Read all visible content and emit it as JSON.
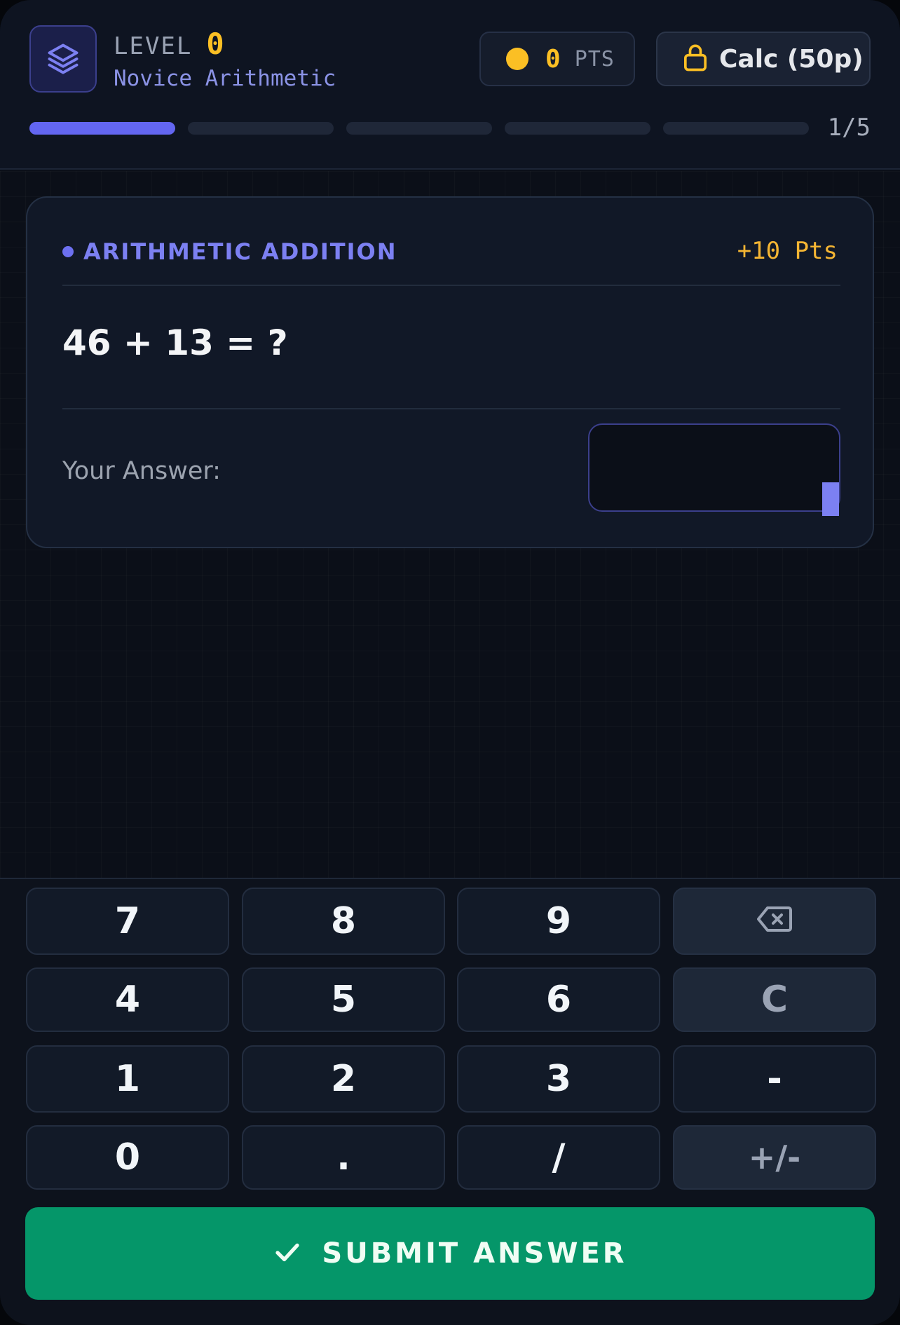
{
  "header": {
    "level_label": "LEVEL",
    "level_value": "0",
    "level_name": "Novice Arithmetic",
    "points_value": "0",
    "points_label": "PTS",
    "calc_label": "Calc (50p)",
    "progress_text": "1/5",
    "progress_total": 5,
    "progress_current": 1
  },
  "question": {
    "topic": "ARITHMETIC ADDITION",
    "reward": "+10 Pts",
    "problem": "46 + 13 = ?",
    "answer_label": "Your Answer:",
    "answer_value": ""
  },
  "keypad": {
    "keys": [
      "7",
      "8",
      "9",
      "⌫",
      "4",
      "5",
      "6",
      "C",
      "1",
      "2",
      "3",
      "-",
      "0",
      ".",
      "/",
      "+/-"
    ]
  },
  "submit": {
    "label": "SUBMIT ANSWER"
  },
  "colors": {
    "accent": "#6366f1",
    "gold": "#fbbf24",
    "success": "#059669",
    "background": "#0b0f18"
  }
}
